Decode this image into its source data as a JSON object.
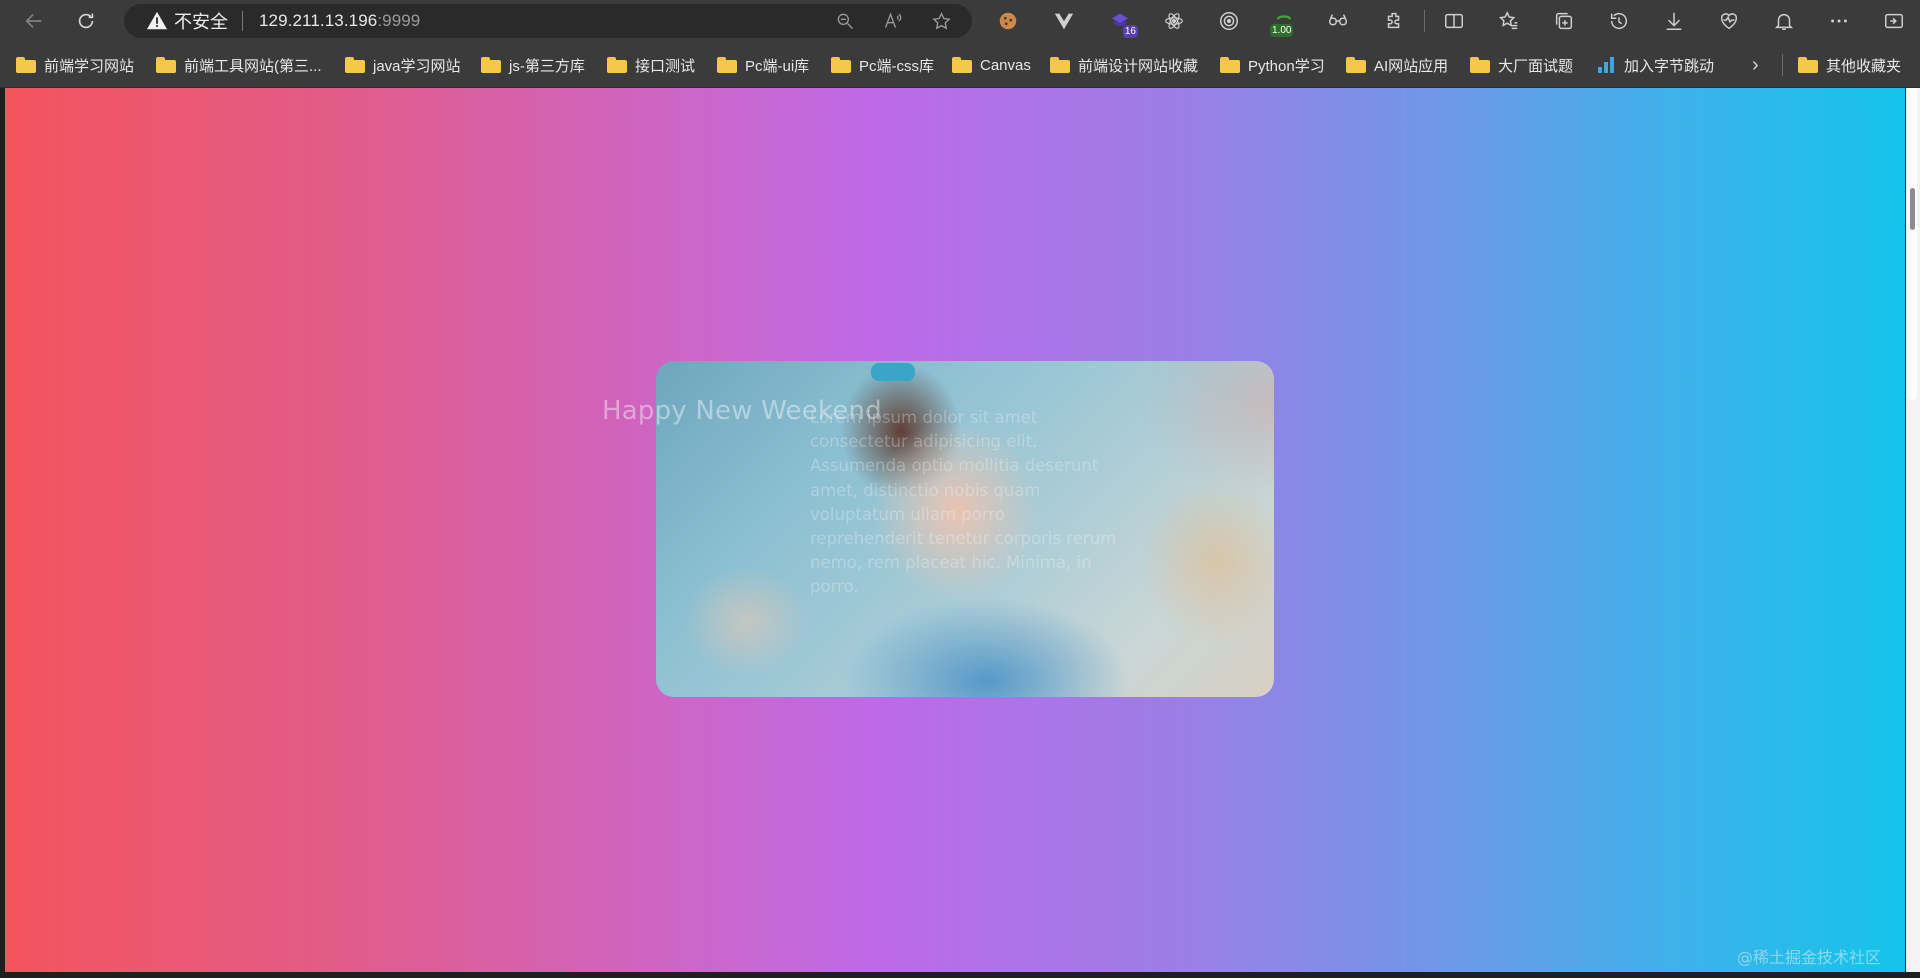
{
  "toolbar": {
    "security_label": "不安全",
    "url_host": "129.211.13.196",
    "url_port": ":9999",
    "extensions": [
      {
        "name": "cookie-icon"
      },
      {
        "name": "vue-devtools-icon"
      },
      {
        "name": "hat-extension-icon",
        "badge": "16"
      },
      {
        "name": "react-devtools-icon"
      },
      {
        "name": "target-extension-icon"
      },
      {
        "name": "speed-extension-icon",
        "badge": "1.00"
      },
      {
        "name": "glasses-extension-icon"
      }
    ]
  },
  "bookmarks": [
    {
      "label": "前端学习网站",
      "icon": "folder-icon"
    },
    {
      "label": "前端工具网站(第三...",
      "icon": "folder-icon"
    },
    {
      "label": "java学习网站",
      "icon": "folder-icon"
    },
    {
      "label": "js-第三方库",
      "icon": "folder-icon"
    },
    {
      "label": "接口测试",
      "icon": "folder-icon"
    },
    {
      "label": "Pc端-ui库",
      "icon": "folder-icon"
    },
    {
      "label": "Pc端-css库",
      "icon": "folder-icon"
    },
    {
      "label": "Canvas",
      "icon": "folder-icon"
    },
    {
      "label": "前端设计网站收藏",
      "icon": "folder-icon"
    },
    {
      "label": "Python学习",
      "icon": "folder-icon"
    },
    {
      "label": "AI网站应用",
      "icon": "folder-icon"
    },
    {
      "label": "大厂面试题",
      "icon": "folder-icon"
    },
    {
      "label": "加入字节跳动",
      "icon": "bar-chart-icon"
    },
    {
      "label": "其他收藏夹",
      "icon": "folder-icon"
    }
  ],
  "page": {
    "title": "Happy New Weekend",
    "paragraph": "Lorem ipsum dolor sit amet consectetur adipisicing elit. Assumenda optio mollitia deserunt amet, distinctio nobis quam voluptatum ullam porro reprehenderit tenetur corporis rerum nemo, rem placeat hic. Minima, in porro.",
    "watermark": "@稀土掘金技术社区"
  },
  "colors": {
    "gradient_start": "#f4545d",
    "gradient_mid": "#bd6ae8",
    "gradient_end": "#14c4ea",
    "chrome_toolbar": "#3b3b3b"
  }
}
